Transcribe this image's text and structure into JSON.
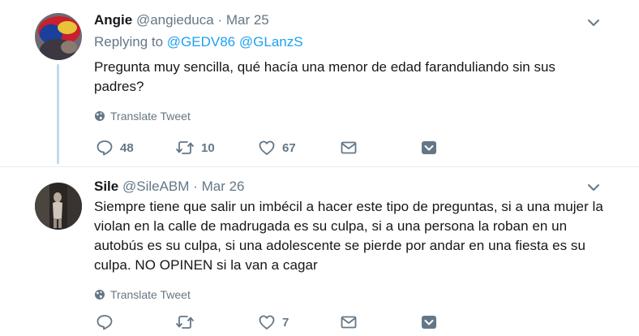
{
  "tweets": [
    {
      "name": "Angie",
      "handle": "@angieduca",
      "separator": "·",
      "date": "Mar 25",
      "reply_prefix": "Replying to",
      "mentions": [
        "@GEDV86",
        "@GLanzS"
      ],
      "text": "Pregunta muy sencilla, qué hacía una menor de edad faranduliando sin sus padres?",
      "translate_label": "Translate Tweet",
      "replies": "48",
      "retweets": "10",
      "likes": "67",
      "icons": {
        "reply": "reply-icon",
        "retweet": "retweet-icon",
        "like": "heart-icon",
        "dm": "envelope-icon",
        "more": "chevron-box-icon",
        "menu": "chevron-down-icon",
        "translate": "globe-icon"
      }
    },
    {
      "name": "Sile",
      "handle": "@SileABM",
      "separator": "·",
      "date": "Mar 26",
      "text": "Siempre tiene que salir un imbécil a hacer este tipo de preguntas, si a una mujer la violan en la calle de madrugada es su culpa, si a una persona la roban en un autobús es su culpa, si una adolescente se pierde por andar en una fiesta es su culpa. NO OPINEN si la van a cagar",
      "translate_label": "Translate Tweet",
      "replies": "",
      "retweets": "",
      "likes": "7",
      "icons": {
        "reply": "reply-icon",
        "retweet": "retweet-icon",
        "like": "heart-icon",
        "dm": "envelope-icon",
        "more": "chevron-box-icon",
        "menu": "chevron-down-icon",
        "translate": "globe-icon"
      }
    }
  ],
  "colors": {
    "link": "#1da1f2",
    "muted": "#657786",
    "text": "#14171a",
    "thread_line": "#c4d9eb",
    "divider": "#e6ecf0"
  }
}
